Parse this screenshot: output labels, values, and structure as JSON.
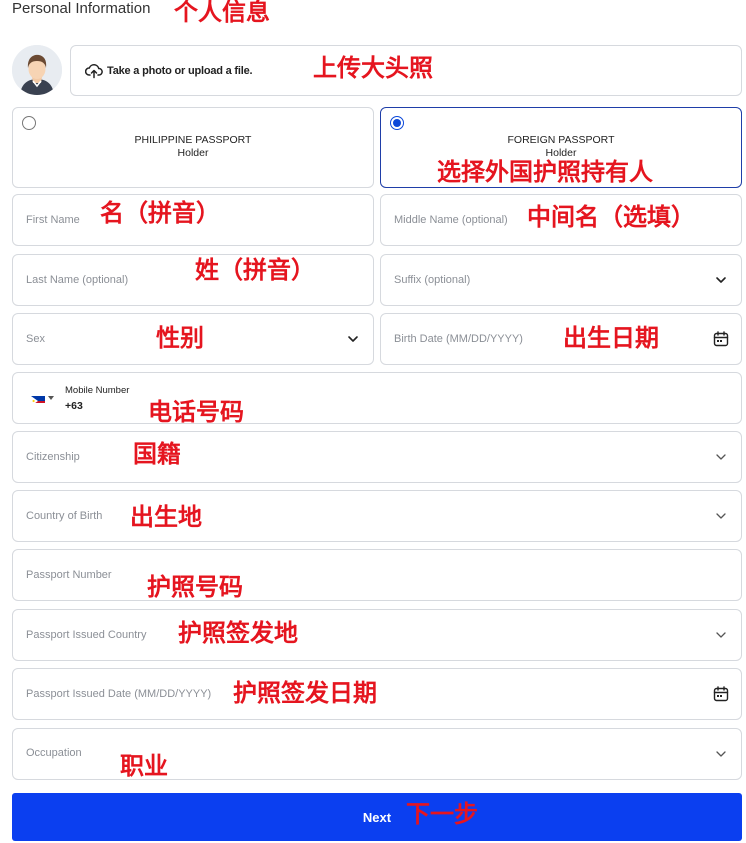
{
  "section_title": "Personal Information",
  "upload": {
    "text": "Take a photo or upload a file."
  },
  "passport_options": [
    {
      "line1": "PHILIPPINE PASSPORT",
      "line2": "Holder",
      "selected": false
    },
    {
      "line1": "FOREIGN PASSPORT",
      "line2": "Holder",
      "selected": true
    }
  ],
  "fields": {
    "first_name": "First Name",
    "middle_name": "Middle Name (optional)",
    "last_name": "Last Name (optional)",
    "suffix": "Suffix (optional)",
    "sex": "Sex",
    "birth_date": "Birth Date (MM/DD/YYYY)",
    "mobile_label": "Mobile Number",
    "mobile_code": "+63",
    "citizenship": "Citizenship",
    "country_of_birth": "Country of Birth",
    "passport_number": "Passport Number",
    "passport_issued_country": "Passport Issued Country",
    "passport_issued_date": "Passport Issued Date (MM/DD/YYYY)",
    "occupation": "Occupation"
  },
  "next_label": "Next",
  "annotations": {
    "personal_info": "个人信息",
    "upload_avatar": "上传大头照",
    "select_foreign": "选择外国护照持有人",
    "first_name": "名（拼音）",
    "middle_name": "中间名（选填）",
    "last_name": "姓（拼音）",
    "sex": "性别",
    "birth_date": "出生日期",
    "phone": "电话号码",
    "citizenship": "国籍",
    "birthplace": "出生地",
    "passport_number": "护照号码",
    "issued_country": "护照签发地",
    "issued_date": "护照签发日期",
    "occupation": "职业",
    "next": "下一步"
  },
  "colors": {
    "primary": "#0b3ff0",
    "selected_border": "#1f3ea8",
    "annotation": "#e5151f"
  }
}
